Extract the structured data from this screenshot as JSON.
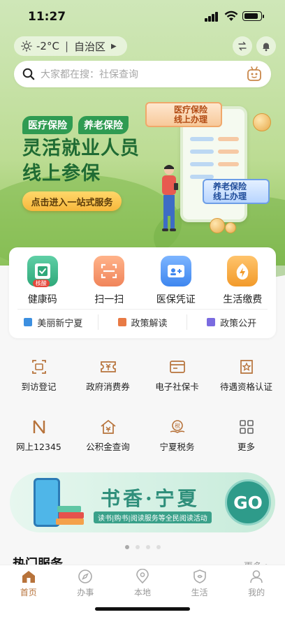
{
  "status_bar": {
    "time": "11:27",
    "battery_level": 0.85
  },
  "header": {
    "temperature": "-2°C",
    "region": "自治区",
    "search_placeholder": "大家都在搜：社保查询"
  },
  "banner": {
    "tags": [
      "医疗保险",
      "养老保险"
    ],
    "title_line1": "灵活就业人员",
    "title_line2": "线上参保",
    "cta": "点击进入一站式服务",
    "card_medical_line1": "医疗保险",
    "card_medical_line2": "线上办理",
    "card_pension_line1": "养老保险",
    "card_pension_line2": "线上办理"
  },
  "quick": {
    "items": [
      {
        "label": "健康码",
        "icon": "health-code-icon",
        "badge": "核酸"
      },
      {
        "label": "扫一扫",
        "icon": "scan-icon"
      },
      {
        "label": "医保凭证",
        "icon": "medical-card-icon"
      },
      {
        "label": "生活缴费",
        "icon": "bill-payment-icon"
      }
    ],
    "links": [
      {
        "label": "美丽新宁夏",
        "icon": "news-icon"
      },
      {
        "label": "政策解读",
        "icon": "policy-icon"
      },
      {
        "label": "政策公开",
        "icon": "document-icon"
      }
    ]
  },
  "services": [
    {
      "label": "到访登记",
      "icon": "visit-register-icon"
    },
    {
      "label": "政府消费券",
      "icon": "coupon-icon"
    },
    {
      "label": "电子社保卡",
      "icon": "social-card-icon"
    },
    {
      "label": "待遇资格认证",
      "icon": "certification-icon"
    },
    {
      "label": "网上12345",
      "icon": "hotline-icon"
    },
    {
      "label": "公积金查询",
      "icon": "housing-fund-icon"
    },
    {
      "label": "宁夏税务",
      "icon": "tax-icon"
    },
    {
      "label": "更多",
      "icon": "more-grid-icon"
    }
  ],
  "reading_banner": {
    "title": "书香·宁夏",
    "subtitle": "读书|购书|阅读服务等全民阅读活动",
    "go": "GO"
  },
  "carousel": {
    "count": 4,
    "active": 0
  },
  "hot": {
    "title": "热门服务",
    "more": "更多 >"
  },
  "tabbar": [
    {
      "label": "首页",
      "icon": "home-icon",
      "active": true
    },
    {
      "label": "办事",
      "icon": "compass-icon",
      "active": false
    },
    {
      "label": "本地",
      "icon": "location-icon",
      "active": false
    },
    {
      "label": "生活",
      "icon": "life-shield-icon",
      "active": false
    },
    {
      "label": "我的",
      "icon": "user-icon",
      "active": false
    }
  ],
  "colors": {
    "accent": "#b7733b",
    "green": "#2f9b52",
    "teal": "#2e9b8a"
  }
}
